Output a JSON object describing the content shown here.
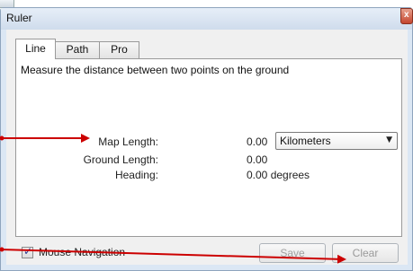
{
  "window": {
    "title": "Ruler",
    "close_symbol": "x"
  },
  "tabs": [
    {
      "label": "Line",
      "active": true
    },
    {
      "label": "Path",
      "active": false
    },
    {
      "label": "Pro",
      "active": false
    }
  ],
  "panel": {
    "description": "Measure the distance between two points on the ground",
    "map_length": {
      "label": "Map Length:",
      "value": "0.00"
    },
    "ground_length": {
      "label": "Ground Length:",
      "value": "0.00"
    },
    "heading": {
      "label": "Heading:",
      "value": "0.00 degrees"
    },
    "units_select": {
      "selected": "Kilometers"
    }
  },
  "footer": {
    "mouse_navigation": {
      "label": "Mouse Navigation",
      "checked": true
    },
    "save_label": "Save",
    "clear_label": "Clear"
  },
  "colors": {
    "annotation_arrow": "#cc0000",
    "window_frame": "#dbe7f4"
  },
  "icons": {
    "close": "close-icon",
    "dropdown": "chevron-down-icon",
    "check": "checkmark-icon"
  }
}
